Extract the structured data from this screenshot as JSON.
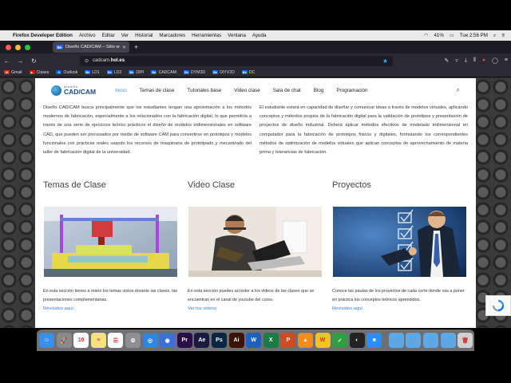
{
  "menubar": {
    "app": "Firefox Developer Edition",
    "items": [
      "Archivo",
      "Editar",
      "Ver",
      "Historial",
      "Marcadores",
      "Herramientas",
      "Ventana",
      "Ayuda"
    ],
    "battery": "41%",
    "clock": "Tue 2:56 PM"
  },
  "tab": {
    "favicon": "Be",
    "title": "Diseño CAD/CAM – Sitio web de"
  },
  "url": {
    "host": "cadcam.",
    "domain": "hol.es"
  },
  "bookmarks": [
    {
      "label": "Gmail",
      "color": "#d93025",
      "icon": "M"
    },
    {
      "label": "Clases",
      "color": "#ff0000",
      "icon": "▶"
    },
    {
      "label": "Outlook",
      "color": "#0a64d6",
      "icon": "O"
    },
    {
      "label": "LD1",
      "color": "#1769ff",
      "icon": "Be"
    },
    {
      "label": "LD2",
      "color": "#1769ff",
      "icon": "Be"
    },
    {
      "label": "DIPI",
      "color": "#1769ff",
      "icon": "Be"
    },
    {
      "label": "CADCAM",
      "color": "#1769ff",
      "icon": "Be"
    },
    {
      "label": "DYM3D",
      "color": "#1769ff",
      "icon": "Be"
    },
    {
      "label": "DIYV2D",
      "color": "#1769ff",
      "icon": "Be"
    },
    {
      "label": "DC",
      "color": "#1769ff",
      "icon": "Be"
    }
  ],
  "site": {
    "logo_small": "diseño",
    "logo_big": "CAD/CAM",
    "nav": [
      "Inicio",
      "Temas de clase",
      "Tutoriales base",
      "Video clase",
      "Sala de chat",
      "Blog",
      "Programación"
    ],
    "intro_left": "Diseño CAD/CAM busca principalmente que los estudiantes tengan una aproximación a los métodos modernos de fabricación, especialmente a los relacionados con la fabricación digital, lo que permitiría a través de una serie de ejercicios teórico prácticos el diseño de modelos tridimensionales en software CAD, que pueden ser procesados por medio de software CAM para convertirse en prototipos y modelos funcionales con prácticas reales usando los recursos de maquinaria de prototipado y mecanizado del taller de fabricación digital de la universidad.",
    "intro_right": "El estudiante estará en capacidad de diseñar y comunicar ideas a través de modelos virtuales, aplicando conceptos y métodos propios de la fabricación digital para la validación de prototipos y presentación de proyectos de diseño industrial. Deberá aplicar métodos efectivos de modelado tridimensional en computador para la fabricación de prototipos físicos y digitales, formulando los correspondientes métodos de optimización de modelos virtuales que aplican conceptos de aprovechamiento de materia prima y tolerancias de fabricación.",
    "sections": [
      {
        "title": "Temas de Clase",
        "desc": "En esta sección tienes a mano los temas vistos durante las clases, las presentaciones complementarias.",
        "link": "Revisalos aquí"
      },
      {
        "title": "Video Clase",
        "desc": "En esta sección puedes acceder a los videos de las clases que se encuentran en el canal de youtube del curso.",
        "link": "Ver los videos"
      },
      {
        "title": "Proyectos",
        "desc": "Conoce las pautas de los proyectos de cada corte donde vas a poner en práctica los conceptos teóricos aprendidos.",
        "link": "Revisalos aquí"
      }
    ]
  },
  "dock": [
    {
      "name": "finder",
      "color": "#3b8ef0",
      "glyph": "☺"
    },
    {
      "name": "launchpad",
      "color": "#8a8a8a",
      "glyph": "🚀"
    },
    {
      "name": "calendar",
      "color": "#ffffff",
      "glyph": "10"
    },
    {
      "name": "notes",
      "color": "#f6e27a",
      "glyph": "≡"
    },
    {
      "name": "reminders",
      "color": "#ffffff",
      "glyph": "☰"
    },
    {
      "name": "system-preferences",
      "color": "#8e8e93",
      "glyph": "⚙"
    },
    {
      "name": "safari",
      "color": "#2e86de",
      "glyph": "◎"
    },
    {
      "name": "firefox",
      "color": "#3d6fd8",
      "glyph": "◉"
    },
    {
      "name": "premiere",
      "color": "#2a0e4a",
      "glyph": "Pr"
    },
    {
      "name": "after-effects",
      "color": "#1b1a3f",
      "glyph": "Ae"
    },
    {
      "name": "photoshop",
      "color": "#0a2540",
      "glyph": "Ps"
    },
    {
      "name": "illustrator",
      "color": "#3a1400",
      "glyph": "Ai"
    },
    {
      "name": "word",
      "color": "#1f5fbf",
      "glyph": "W"
    },
    {
      "name": "excel",
      "color": "#1d7a45",
      "glyph": "X"
    },
    {
      "name": "powerpoint",
      "color": "#d04b23",
      "glyph": "P"
    },
    {
      "name": "vlc",
      "color": "#f28c1b",
      "glyph": "▲"
    },
    {
      "name": "app-yellow",
      "color": "#f0c419",
      "glyph": "W"
    },
    {
      "name": "app-green",
      "color": "#2f9e44",
      "glyph": "✓"
    },
    {
      "name": "obs",
      "color": "#222",
      "glyph": "◐"
    },
    {
      "name": "zoom",
      "color": "#2d8cff",
      "glyph": "■"
    },
    {
      "name": "folder-1",
      "color": "#5fa8e8",
      "glyph": ""
    },
    {
      "name": "folder-2",
      "color": "#5fa8e8",
      "glyph": ""
    },
    {
      "name": "folder-3",
      "color": "#5fa8e8",
      "glyph": ""
    },
    {
      "name": "folder-4",
      "color": "#5fa8e8",
      "glyph": ""
    },
    {
      "name": "trash",
      "color": "#d0d0d0",
      "glyph": "🗑"
    }
  ]
}
